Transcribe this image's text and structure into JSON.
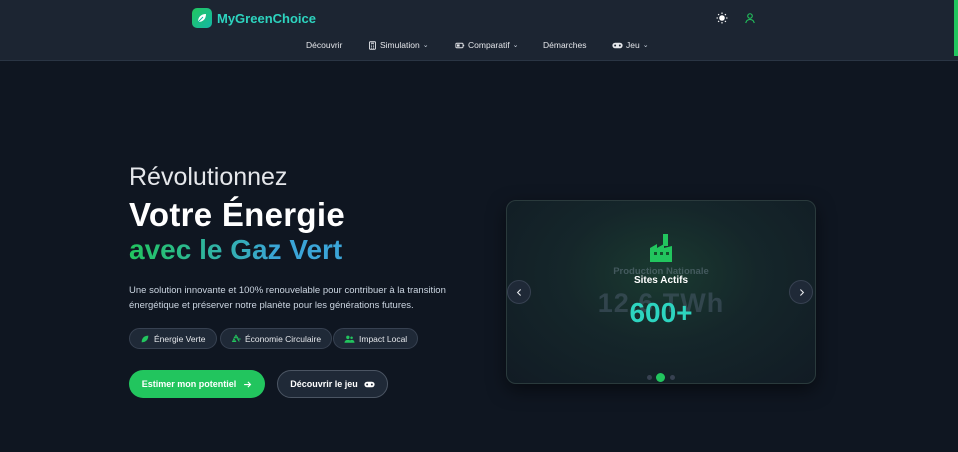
{
  "header": {
    "brand": "MyGreenChoice",
    "nav": [
      {
        "label": "Découvrir"
      },
      {
        "label": "Simulation"
      },
      {
        "label": "Comparatif"
      },
      {
        "label": "Démarches"
      },
      {
        "label": "Jeu"
      }
    ],
    "icons": [
      "leaf-icon",
      "sun-icon",
      "user-icon",
      "calculator-icon",
      "battery-icon",
      "gamepad-icon",
      "chevron-down-icon"
    ]
  },
  "hero": {
    "line1": "Révolutionnez",
    "line2": "Votre Énergie",
    "line3": "avec le Gaz Vert",
    "description": "Une solution innovante et 100% renouvelable pour contribuer à la transition énergétique et préserver notre planète pour les générations futures.",
    "tags": [
      {
        "label": "Énergie Verte",
        "icon": "leaf-icon"
      },
      {
        "label": "Économie Circulaire",
        "icon": "recycle-icon"
      },
      {
        "label": "Impact Local",
        "icon": "users-icon"
      }
    ],
    "cta_primary": "Estimer mon potentiel",
    "cta_secondary": "Découvrir le jeu"
  },
  "carousel": {
    "active_slide": {
      "title": "Sites Actifs",
      "value": "600+",
      "icon": "factory-icon"
    },
    "previous_slide_fading": {
      "title": "Production Nationale",
      "value": "12.6 TWh"
    },
    "dots": 3,
    "active_dot": 1
  },
  "colors": {
    "accent_green": "#22c55e",
    "accent_teal": "#2dd4bf",
    "accent_blue": "#3ba5d8",
    "background": "#0f1621",
    "header_bg": "#1c2532"
  }
}
